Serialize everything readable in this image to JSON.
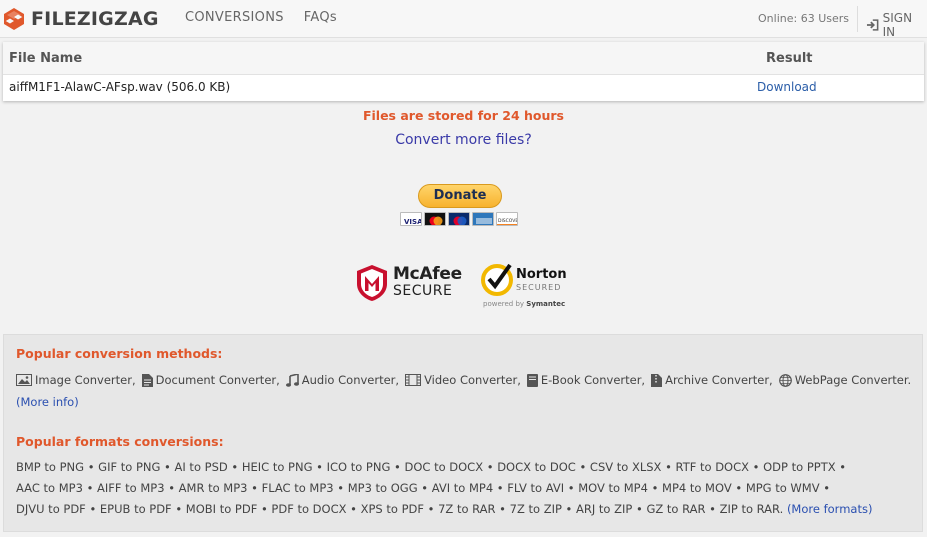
{
  "brand": {
    "name": "FILEZIGZAG"
  },
  "nav": [
    {
      "label": "CONVERSIONS"
    },
    {
      "label": "FAQs"
    }
  ],
  "header": {
    "online": "Online: 63 Users",
    "signin": "SIGN IN"
  },
  "table": {
    "col_file": "File Name",
    "col_result": "Result",
    "rows": [
      {
        "file": "aiffM1F1-AlawC-AFsp.wav (506.0 KB)",
        "result": "Download"
      }
    ]
  },
  "notice": "Files are stored for 24 hours",
  "convert_more": "Convert more files?",
  "donate": {
    "label": "Donate",
    "cards": [
      "visa-icon",
      "mastercard-icon",
      "maestro-icon",
      "amex-icon",
      "discover-icon"
    ]
  },
  "badges": {
    "mcafee_top": "McAfee",
    "mcafee_bottom": "SECURE",
    "norton_top": "Norton",
    "norton_mid": "SECURED",
    "norton_by_prefix": "powered by",
    "norton_by_name": "Symantec"
  },
  "popular": {
    "methods_title": "Popular conversion methods:",
    "methods": [
      {
        "label": "Image Converter,",
        "icon": "image-icon"
      },
      {
        "label": "Document Converter,",
        "icon": "document-icon"
      },
      {
        "label": "Audio Converter,",
        "icon": "music-icon"
      },
      {
        "label": "Video Converter,",
        "icon": "film-icon"
      },
      {
        "label": "E-Book Converter,",
        "icon": "book-icon"
      },
      {
        "label": "Archive Converter,",
        "icon": "archive-icon"
      },
      {
        "label": "WebPage Converter.",
        "icon": "globe-icon"
      }
    ],
    "more_info": "(More info)",
    "formats_title": "Popular formats conversions:",
    "formats": [
      "BMP to PNG",
      "GIF to PNG",
      "AI to PSD",
      "HEIC to PNG",
      "ICO to PNG",
      "DOC to DOCX",
      "DOCX to DOC",
      "CSV to XLSX",
      "RTF to DOCX",
      "ODP to PPTX",
      "AAC to MP3",
      "AIFF to MP3",
      "AMR to MP3",
      "FLAC to MP3",
      "MP3 to OGG",
      "AVI to MP4",
      "FLV to AVI",
      "MOV to MP4",
      "MP4 to MOV",
      "MPG to WMV",
      "DJVU to PDF",
      "EPUB to PDF",
      "MOBI to PDF",
      "PDF to DOCX",
      "XPS to PDF",
      "7Z to RAR",
      "7Z to ZIP",
      "ARJ to ZIP",
      "GZ to RAR",
      "ZIP to RAR."
    ],
    "more_formats": "(More formats)"
  },
  "colors": {
    "accent": "#e0582c",
    "link": "#2a4fb0",
    "donate": "#f7b22e"
  }
}
